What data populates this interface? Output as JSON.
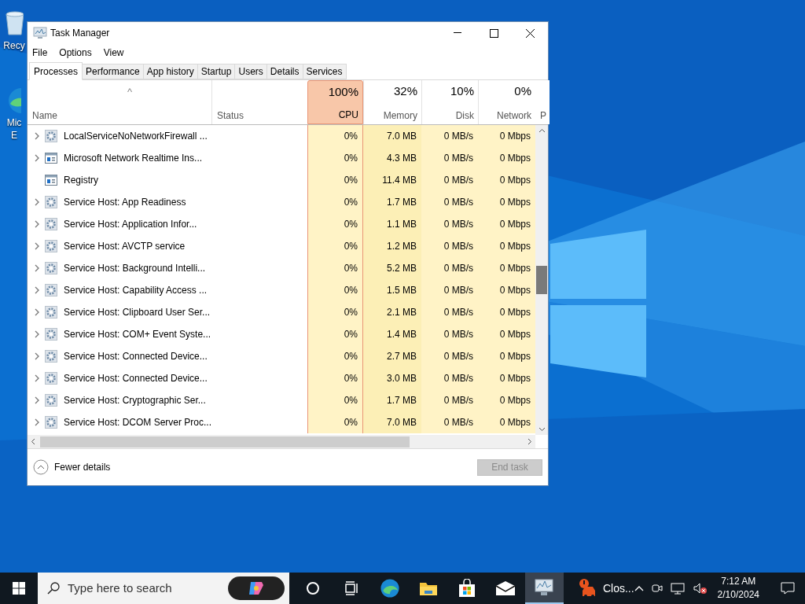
{
  "desktop_icons": [
    {
      "label": "Recy",
      "kind": "bin"
    },
    {
      "label": "Mic E",
      "kind": "edge"
    }
  ],
  "window": {
    "title": "Task Manager",
    "menu": [
      "File",
      "Options",
      "View"
    ],
    "tabs": [
      {
        "label": "Processes",
        "selected": true
      },
      {
        "label": "Performance",
        "selected": false
      },
      {
        "label": "App history",
        "selected": false
      },
      {
        "label": "Startup",
        "selected": false
      },
      {
        "label": "Users",
        "selected": false
      },
      {
        "label": "Details",
        "selected": false
      },
      {
        "label": "Services",
        "selected": false
      }
    ],
    "sort_arrow": "^",
    "columns": [
      {
        "label": "Name"
      },
      {
        "label": "Status"
      },
      {
        "percent": "100%",
        "label": "CPU",
        "highlighted": true,
        "color": "#fff3c6"
      },
      {
        "percent": "32%",
        "label": "Memory",
        "highlighted": false,
        "color": "#fcefb6"
      },
      {
        "percent": "10%",
        "label": "Disk",
        "highlighted": false,
        "color": "#fff3c6"
      },
      {
        "percent": "0%",
        "label": "Network",
        "highlighted": false,
        "color": "#fff3c6"
      },
      {
        "label": "P"
      }
    ],
    "rows": [
      {
        "name": "LocalServiceNoNetworkFirewall ...",
        "kind": "gear",
        "expandable": true,
        "cpu": "0%",
        "memory": "7.0 MB",
        "disk": "0 MB/s",
        "network": "0 Mbps"
      },
      {
        "name": "Microsoft Network Realtime Ins...",
        "kind": "window",
        "expandable": true,
        "cpu": "0%",
        "memory": "4.3 MB",
        "disk": "0 MB/s",
        "network": "0 Mbps"
      },
      {
        "name": "Registry",
        "kind": "window",
        "expandable": false,
        "cpu": "0%",
        "memory": "11.4 MB",
        "disk": "0 MB/s",
        "network": "0 Mbps"
      },
      {
        "name": "Service Host: App Readiness",
        "kind": "gear",
        "expandable": true,
        "cpu": "0%",
        "memory": "1.7 MB",
        "disk": "0 MB/s",
        "network": "0 Mbps"
      },
      {
        "name": "Service Host: Application Infor...",
        "kind": "gear",
        "expandable": true,
        "cpu": "0%",
        "memory": "1.1 MB",
        "disk": "0 MB/s",
        "network": "0 Mbps"
      },
      {
        "name": "Service Host: AVCTP service",
        "kind": "gear",
        "expandable": true,
        "cpu": "0%",
        "memory": "1.2 MB",
        "disk": "0 MB/s",
        "network": "0 Mbps"
      },
      {
        "name": "Service Host: Background Intelli...",
        "kind": "gear",
        "expandable": true,
        "cpu": "0%",
        "memory": "5.2 MB",
        "disk": "0 MB/s",
        "network": "0 Mbps"
      },
      {
        "name": "Service Host: Capability Access ...",
        "kind": "gear",
        "expandable": true,
        "cpu": "0%",
        "memory": "1.5 MB",
        "disk": "0 MB/s",
        "network": "0 Mbps"
      },
      {
        "name": "Service Host: Clipboard User Ser...",
        "kind": "gear",
        "expandable": true,
        "cpu": "0%",
        "memory": "2.1 MB",
        "disk": "0 MB/s",
        "network": "0 Mbps"
      },
      {
        "name": "Service Host: COM+ Event Syste...",
        "kind": "gear",
        "expandable": true,
        "cpu": "0%",
        "memory": "1.4 MB",
        "disk": "0 MB/s",
        "network": "0 Mbps"
      },
      {
        "name": "Service Host: Connected Device...",
        "kind": "gear",
        "expandable": true,
        "cpu": "0%",
        "memory": "2.7 MB",
        "disk": "0 MB/s",
        "network": "0 Mbps"
      },
      {
        "name": "Service Host: Connected Device...",
        "kind": "gear",
        "expandable": true,
        "cpu": "0%",
        "memory": "3.0 MB",
        "disk": "0 MB/s",
        "network": "0 Mbps"
      },
      {
        "name": "Service Host: Cryptographic Ser...",
        "kind": "gear",
        "expandable": true,
        "cpu": "0%",
        "memory": "1.7 MB",
        "disk": "0 MB/s",
        "network": "0 Mbps"
      },
      {
        "name": "Service Host: DCOM Server Proc...",
        "kind": "gear",
        "expandable": true,
        "cpu": "0%",
        "memory": "7.0 MB",
        "disk": "0 MB/s",
        "network": "0 Mbps"
      }
    ],
    "fewer_details": "Fewer details",
    "end_task": {
      "label": "End task",
      "disabled": true
    }
  },
  "taskbar": {
    "search_placeholder": "Type here to search",
    "apps": [
      {
        "kind": "cortana",
        "active": false
      },
      {
        "kind": "taskview",
        "active": false
      },
      {
        "kind": "edge",
        "active": false
      },
      {
        "kind": "folder",
        "active": false
      },
      {
        "kind": "store",
        "active": false
      },
      {
        "kind": "mail",
        "active": false
      },
      {
        "kind": "taskmgr",
        "active": true
      }
    ],
    "notification_app": "Clos...",
    "time": "7:12 AM",
    "date": "2/10/2024"
  }
}
